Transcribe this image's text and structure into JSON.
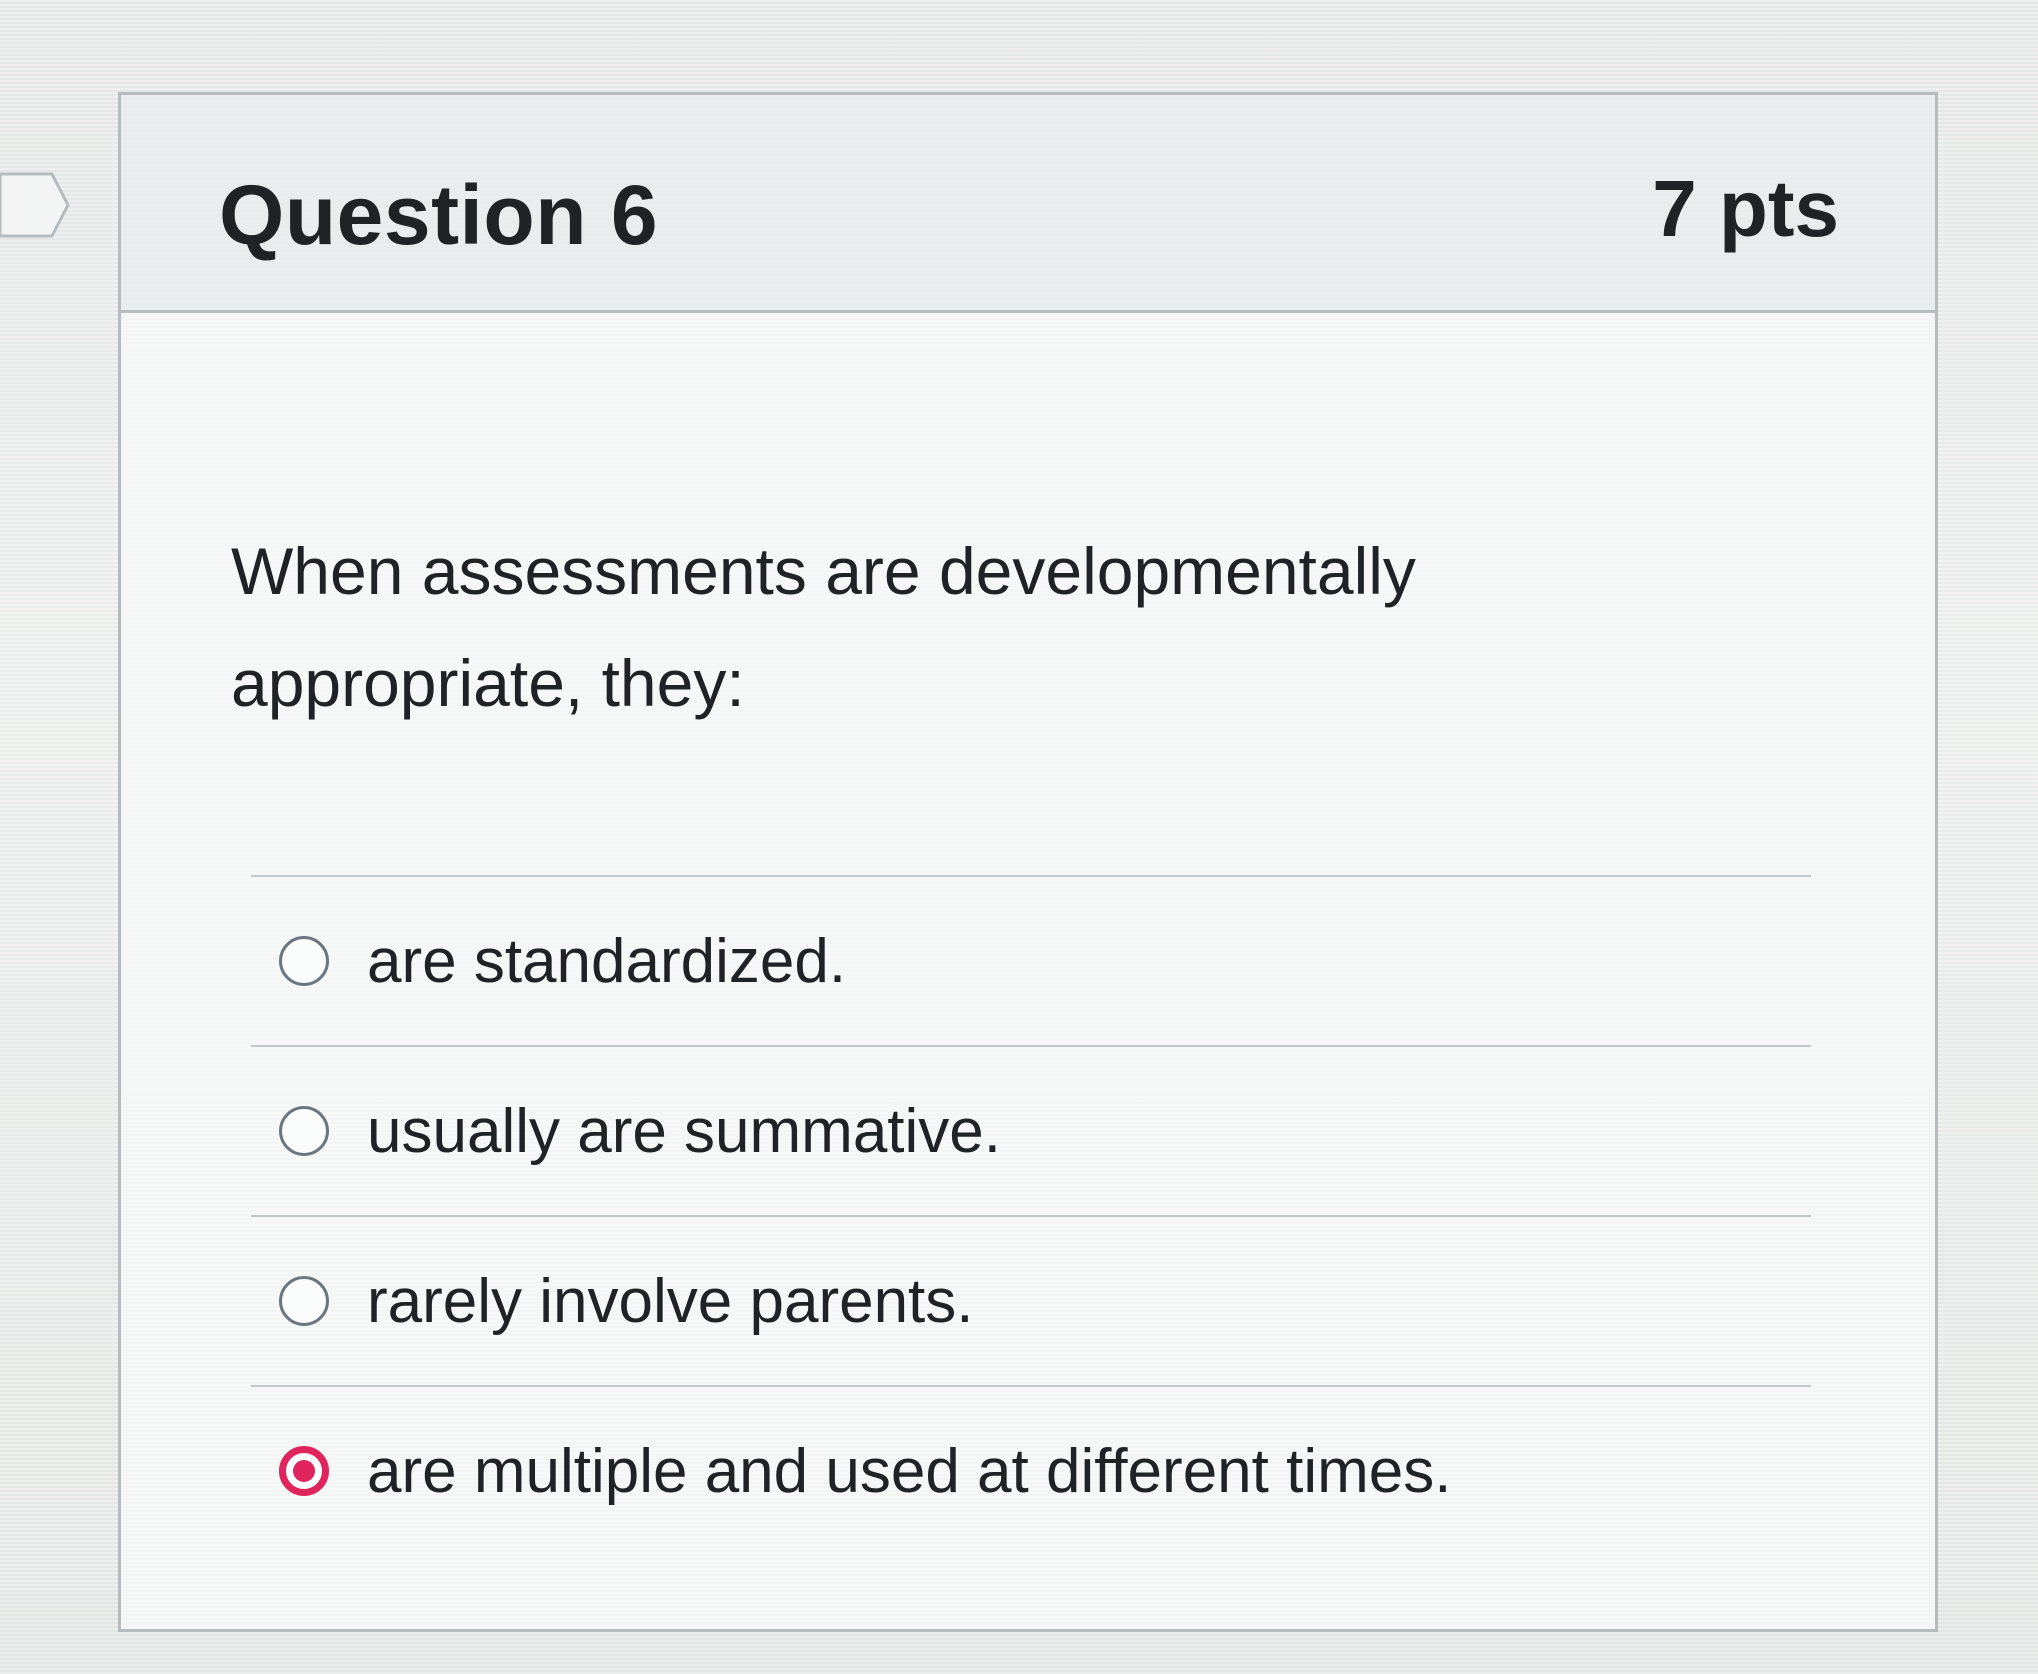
{
  "question": {
    "title": "Question 6",
    "points": "7 pts",
    "text": "When assessments are developmentally appropriate, they:",
    "answers": [
      {
        "label": "are standardized.",
        "selected": false
      },
      {
        "label": "usually are summative.",
        "selected": false
      },
      {
        "label": "rarely involve parents.",
        "selected": false
      },
      {
        "label": "are multiple and used at different times.",
        "selected": true
      }
    ]
  },
  "colors": {
    "accent_selected": "#e0245e",
    "text": "#1f2326",
    "border": "#b6bcbd"
  },
  "icons": {
    "nav_marker": "chevron-right-icon",
    "radio_unselected": "radio-empty-icon",
    "radio_selected": "radio-filled-icon"
  }
}
